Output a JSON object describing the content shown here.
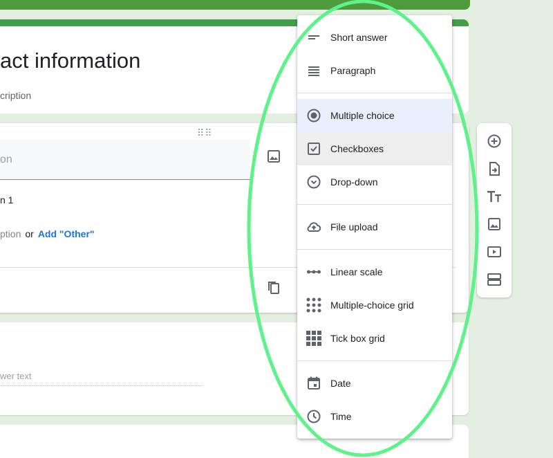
{
  "form": {
    "title": "act information",
    "description": "cription"
  },
  "question": {
    "title_placeholder": "on",
    "option_1": "n 1",
    "add_option": "ption",
    "or_text": "or",
    "add_other": "Add \"Other\""
  },
  "question2": {
    "answer_placeholder": "wer text"
  },
  "type_menu": {
    "selected": "Multiple choice",
    "items": [
      {
        "label": "Short answer",
        "icon": "short-answer-icon"
      },
      {
        "label": "Paragraph",
        "icon": "paragraph-icon"
      },
      {
        "label": "Multiple choice",
        "icon": "radio-button-icon"
      },
      {
        "label": "Checkboxes",
        "icon": "checkbox-icon"
      },
      {
        "label": "Drop-down",
        "icon": "dropdown-circle-icon"
      },
      {
        "label": "File upload",
        "icon": "cloud-upload-icon"
      },
      {
        "label": "Linear scale",
        "icon": "linear-scale-icon"
      },
      {
        "label": "Multiple-choice grid",
        "icon": "dot-grid-icon"
      },
      {
        "label": "Tick box grid",
        "icon": "square-grid-icon"
      },
      {
        "label": "Date",
        "icon": "calendar-icon"
      },
      {
        "label": "Time",
        "icon": "clock-icon"
      }
    ]
  },
  "toolbar": {
    "buttons": [
      "add-question-icon",
      "import-questions-icon",
      "add-title-icon",
      "add-image-icon",
      "add-video-icon",
      "add-section-icon"
    ]
  },
  "colors": {
    "theme": "#43a047",
    "background": "#e3efe0",
    "highlight": "#5ef28a",
    "selected_bg": "#e8f0fe",
    "link": "#1a73e8"
  }
}
